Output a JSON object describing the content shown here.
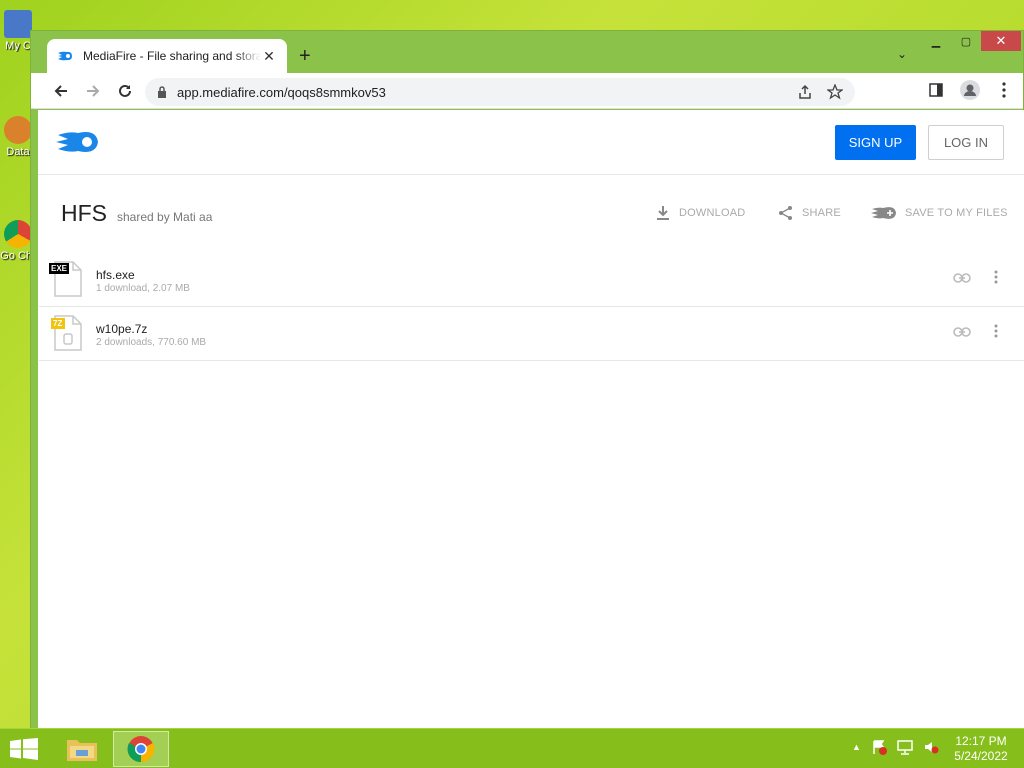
{
  "desktop": {
    "icons": [
      {
        "label": "My C"
      },
      {
        "label": "Data"
      },
      {
        "label": "Go Chr"
      }
    ]
  },
  "browser": {
    "tab": {
      "title": "MediaFire - File sharing and storage made simple"
    },
    "window_controls": {
      "minimize": "▁",
      "maximize": "▢",
      "close": "✕"
    },
    "new_tab": "+",
    "tab_menu": "⌄",
    "address": {
      "url": "app.mediafire.com/qoqs8smmkov53"
    }
  },
  "mediafire": {
    "header": {
      "signup": "SIGN UP",
      "login": "LOG IN"
    },
    "folder": {
      "name": "HFS",
      "shared_by": "shared by Mati aa",
      "actions": {
        "download": "DOWNLOAD",
        "share": "SHARE",
        "save": "SAVE TO MY FILES"
      }
    },
    "files": [
      {
        "name": "hfs.exe",
        "meta": "1 download, 2.07 MB",
        "badge": "EXE"
      },
      {
        "name": "w10pe.7z",
        "meta": "2 downloads, 770.60 MB",
        "badge": "7Z"
      }
    ]
  },
  "taskbar": {
    "clock": {
      "time": "12:17 PM",
      "date": "5/24/2022"
    }
  },
  "colors": {
    "accent": "#0070f0",
    "desktop": "#9fd21f",
    "tabstrip": "#8bc34a",
    "taskbar": "#86bf1c"
  }
}
